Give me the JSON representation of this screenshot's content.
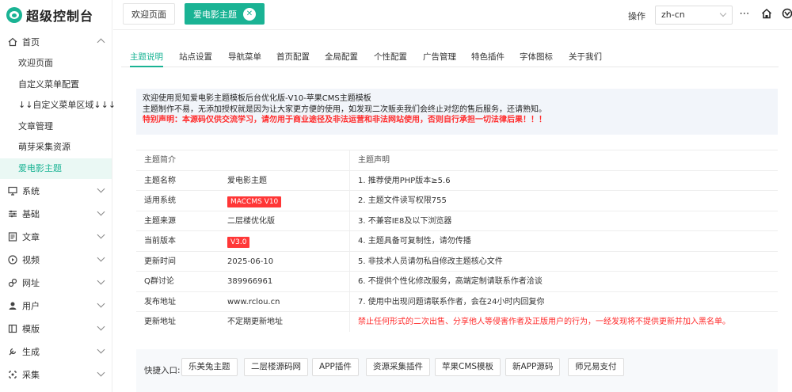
{
  "app": {
    "title": "超级控制台"
  },
  "sidebar": {
    "home": {
      "label": "首页",
      "sub": [
        "欢迎页面",
        "自定义菜单配置",
        "↓↓自定义菜单区域↓↓↓",
        "文章管理",
        "萌芽采集资源",
        "爱电影主题"
      ],
      "active_sub": "爱电影主题"
    },
    "groups": [
      {
        "label": "系统",
        "icon": "monitor-icon"
      },
      {
        "label": "基础",
        "icon": "sliders-icon"
      },
      {
        "label": "文章",
        "icon": "article-icon"
      },
      {
        "label": "视频",
        "icon": "play-circle-icon"
      },
      {
        "label": "网址",
        "icon": "link-icon"
      },
      {
        "label": "用户",
        "icon": "user-icon"
      },
      {
        "label": "模版",
        "icon": "template-icon"
      },
      {
        "label": "生成",
        "icon": "build-icon"
      },
      {
        "label": "采集",
        "icon": "collect-icon"
      }
    ]
  },
  "topbar": {
    "tabs": [
      {
        "label": "欢迎页面"
      },
      {
        "label": "爱电影主题",
        "active": true
      }
    ],
    "action_label": "操作",
    "language": "zh-cn",
    "icons": [
      "more-icon",
      "home-icon",
      "user-icon"
    ]
  },
  "content": {
    "nav": [
      "主题说明",
      "站点设置",
      "导航菜单",
      "首页配置",
      "全局配置",
      "个性配置",
      "广告管理",
      "特色插件",
      "字体图标",
      "关于我们"
    ],
    "active_nav": "主题说明",
    "notice": {
      "line1": "欢迎使用觅知爱电影主题模板后台优化版-V10-苹果CMS主题模板",
      "line2": "主题制作不易，无添加授权就是因为让大家更方便的使用，如发现二次贩卖我们会终止对您的售后服务，还请熟知。",
      "line3": "特别声明：本源码仅供交流学习，请勿用于商业途径及非法运营和非法网站使用，否则自行承担一切法律后果！！！"
    },
    "intro": {
      "header": "主题简介",
      "rows": [
        {
          "k": "主题名称",
          "v": "爱电影主题"
        },
        {
          "k": "适用系统",
          "v": "MACCMS V10",
          "badge": true
        },
        {
          "k": "主题来源",
          "v": "二层楼优化版"
        },
        {
          "k": "当前版本",
          "v": "V3.0",
          "badge": true
        },
        {
          "k": "更新时间",
          "v": "2025-06-10"
        },
        {
          "k": "Q群讨论",
          "v": "389966961"
        },
        {
          "k": "发布地址",
          "v": "www.rclou.cn"
        },
        {
          "k": "更新地址",
          "v": "不定期更新地址"
        }
      ]
    },
    "declaration": {
      "header": "主题声明",
      "items": [
        "1. 推荐使用PHP版本≥5.6",
        "2. 主题文件读写权限755",
        "3. 不兼容IE8及以下浏览器",
        "4. 主题具备可复制性，请勿传播",
        "5. 非技术人员请勿私自修改主题核心文件",
        "6. 不提供个性化修改服务，高端定制请联系作者洽谈",
        "7. 使用中出现问题请联系作者，会在24小时内回复你"
      ],
      "warning": "禁止任何形式的二次出售、分享他人等侵害作者及正版用户的行为，一经发现将不提供更新并加入黑名单。"
    },
    "quick": {
      "label": "快捷入口:",
      "buttons": [
        "乐美兔主题",
        "二层楼源码网",
        "APP插件",
        "资源采集插件",
        "苹果CMS模板",
        "新APP源码",
        "师兄易支付"
      ]
    }
  },
  "colors": {
    "accent": "#1ab394",
    "danger": "#ff2b2b",
    "notice_bg": "#f2f5fa"
  }
}
